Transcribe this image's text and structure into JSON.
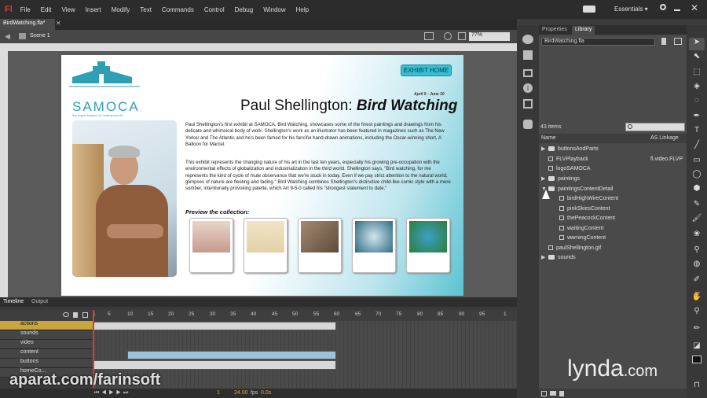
{
  "app": {
    "logo": "Fl"
  },
  "menu": [
    "File",
    "Edit",
    "View",
    "Insert",
    "Modify",
    "Text",
    "Commands",
    "Control",
    "Debug",
    "Window",
    "Help"
  ],
  "workspace": "Essentials ▾",
  "document": {
    "tab": "BirdWatching.fla*",
    "scene": "Scene 1",
    "zoom": "77%"
  },
  "stage": {
    "logo_text": "SAMOCA",
    "logo_sub": "San Angelo Museum of Contemporary Art",
    "exhibit_button": "EXHIBIT HOME",
    "dates": "April 5 - June 30",
    "title_prefix": "Paul Shellington: ",
    "title_italic": "Bird Watching",
    "para1": "Paul Shellington's first exhibit at SAMOCA, Bird Watching, showcases some of the finest paintings and drawings from his delicate and whimsical body of work. Shellington's work as an illustrator has been featured in magazines such as The New Yorker and The Atlantic and he's been famed for his fanciful hand-drawn animations, including the Oscar-winning short, A Balloon for Marcel.",
    "para2": "This exhibit represents the changing nature of his art in the last ten years, especially his growing pre-occupation with the environmental effects of globalization and industrialization in the third world. Shellington says, \"Bird watching, for me represents the kind of cycle of mute observance that we're stuck in today. Even if we pay strict attention to the natural world, glimpses of nature are fleeting and fading.\" Bird Watching combines Shellington's distinctive child-like comic style with a more somber, intentionally provoking palette, which Art 9-5-0 called his \"strongest statement to date.\"",
    "preview_label": "Preview the collection:"
  },
  "timeline": {
    "tabs": [
      "Timeline",
      "Output"
    ],
    "frame_numbers": [
      "1",
      "5",
      "10",
      "15",
      "20",
      "25",
      "30",
      "35",
      "40",
      "45",
      "50",
      "55",
      "60",
      "65",
      "70",
      "75",
      "80",
      "85",
      "90",
      "95",
      "1"
    ],
    "layers": [
      "actions",
      "sounds",
      "video",
      "content",
      "buttons",
      "homeCo..."
    ],
    "fps": "24.00",
    "fps_unit": "fps",
    "time": "0.0s",
    "frame": "1"
  },
  "panel": {
    "tabs": [
      "Properties",
      "Library"
    ],
    "library_file": "BirdWatching.fla",
    "item_count": "43 items",
    "col_name": "Name",
    "col_linkage": "AS Linkage",
    "items": [
      {
        "name": "buttonsAndParts",
        "type": "folder",
        "indent": 0,
        "linkage": ""
      },
      {
        "name": "FLVPlayback",
        "type": "symbol",
        "indent": 0,
        "linkage": "fl.video.FLVP"
      },
      {
        "name": "logoSAMOCA",
        "type": "symbol",
        "indent": 0,
        "linkage": ""
      },
      {
        "name": "paintings",
        "type": "folder",
        "indent": 0,
        "linkage": ""
      },
      {
        "name": "paintingsContentDetail",
        "type": "folder",
        "indent": 0,
        "linkage": ""
      },
      {
        "name": "birdHighWireContent",
        "type": "symbol",
        "indent": 1,
        "linkage": ""
      },
      {
        "name": "pinkSkiesContent",
        "type": "symbol",
        "indent": 1,
        "linkage": ""
      },
      {
        "name": "thePeacockContent",
        "type": "symbol",
        "indent": 1,
        "linkage": ""
      },
      {
        "name": "waitingContent",
        "type": "symbol",
        "indent": 1,
        "linkage": ""
      },
      {
        "name": "warningContent",
        "type": "symbol",
        "indent": 1,
        "linkage": ""
      },
      {
        "name": "paulShellington.gif",
        "type": "symbol",
        "indent": 0,
        "linkage": ""
      },
      {
        "name": "sounds",
        "type": "folder",
        "indent": 0,
        "linkage": ""
      }
    ]
  },
  "watermarks": {
    "left": "aparat.com/farinsoft",
    "right_brand": "lynda",
    "right_suffix": ".com"
  }
}
